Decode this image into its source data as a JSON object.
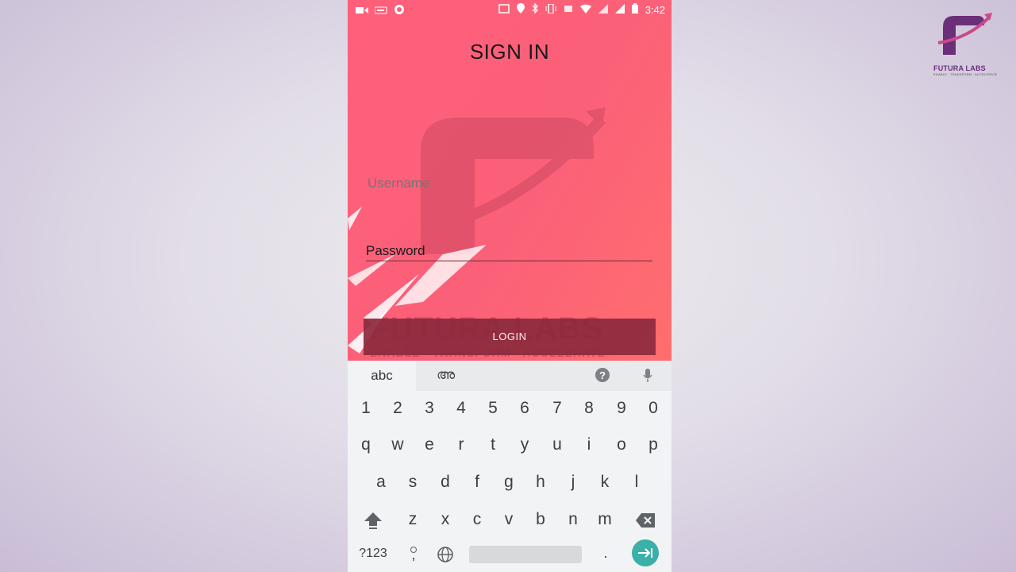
{
  "status_bar": {
    "time": "3:42",
    "icons_left": [
      "video-camera-icon",
      "keyboard-icon",
      "circle-icon"
    ],
    "icons_right": [
      "cast-icon",
      "location-icon",
      "bluetooth-icon",
      "vibrate-icon",
      "4g-icon",
      "wifi-icon",
      "signal-icon",
      "signal-icon",
      "battery-icon"
    ]
  },
  "screen": {
    "title": "SIGN IN",
    "username_placeholder": "Username",
    "password_label": "Password",
    "login_button": "LOGIN",
    "watermark_title": "FUTURA LABS",
    "watermark_subtitle": "ENABLE · TRANSFORM · ACCELERATE"
  },
  "keyboard": {
    "tab_abc": "abc",
    "tab_malayalam": "അ",
    "number_row": [
      "1",
      "2",
      "3",
      "4",
      "5",
      "6",
      "7",
      "8",
      "9",
      "0"
    ],
    "row1": [
      "q",
      "w",
      "e",
      "r",
      "t",
      "y",
      "u",
      "i",
      "o",
      "p"
    ],
    "row2": [
      "a",
      "s",
      "d",
      "f",
      "g",
      "h",
      "j",
      "k",
      "l"
    ],
    "row3": [
      "z",
      "x",
      "c",
      "v",
      "b",
      "n",
      "m"
    ],
    "symbols_key": "?123",
    "comma_key": ",",
    "period_key": "."
  },
  "brand": {
    "name": "FUTURA LABS",
    "tagline": "ENABLE · TRANSFORM · ACCELERATE",
    "accent": "#6b2f7a"
  },
  "colors": {
    "app_background": "#fb6079",
    "login_button": "#8d2a3d",
    "keyboard_background": "#f1f3f4",
    "enter_key": "#3ab0a9"
  }
}
